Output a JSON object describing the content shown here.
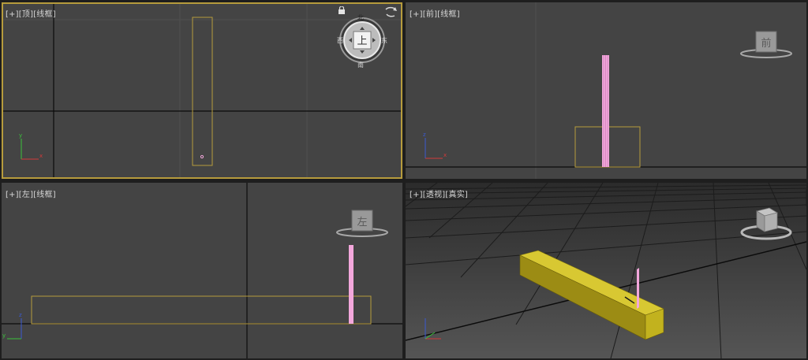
{
  "viewports": {
    "top": {
      "label_plus": "[+]",
      "label_view": "[顶]",
      "label_mode": "[线框]",
      "viewcube": {
        "face": "上",
        "north": "北",
        "south": "南",
        "east": "东",
        "west": "西"
      }
    },
    "front": {
      "label_plus": "[+]",
      "label_view": "[前]",
      "label_mode": "[线框]",
      "viewcube": {
        "face": "前"
      }
    },
    "left": {
      "label_plus": "[+]",
      "label_view": "[左]",
      "label_mode": "[线框]",
      "viewcube": {
        "face": "左"
      }
    },
    "perspective": {
      "label_plus": "[+]",
      "label_view": "[透视]",
      "label_mode": "[真实]"
    }
  },
  "axis_labels": {
    "x": "x",
    "y": "y",
    "z": "z"
  },
  "colors": {
    "active_border": "#b69b3c",
    "viewport_bg": "#444444",
    "selected_wire": "#b69b3c",
    "stick_pink": "#f3a7dc",
    "beam_yellow": "#bfae1c",
    "axis_x": "#d23a3a",
    "axis_y": "#3ac23a",
    "axis_z": "#3a5ad2"
  },
  "icons": {
    "lock": "home-lock-icon",
    "orbit": "orbit-icon"
  }
}
